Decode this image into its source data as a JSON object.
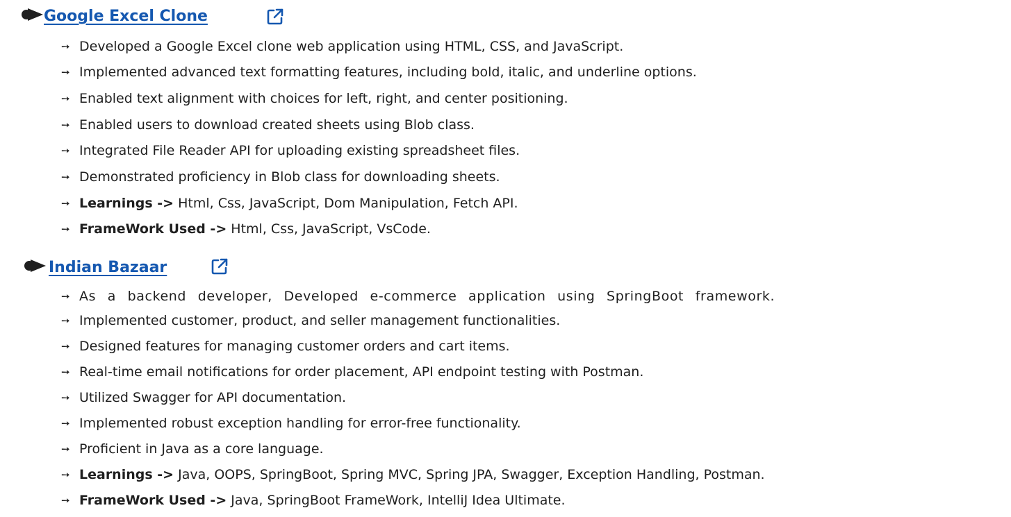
{
  "projects": [
    {
      "title": "Google Excel Clone",
      "icon": "external-link-icon",
      "bullet_icon": "arrow-bullet-icon",
      "items": [
        {
          "text": "Developed a Google Excel clone web application using HTML, CSS, and JavaScript."
        },
        {
          "text": "Implemented advanced text formatting features, including bold, italic, and underline options."
        },
        {
          "text": "Enabled text alignment with choices for left, right, and center positioning."
        },
        {
          "text": "Enabled users to download created sheets using Blob class."
        },
        {
          "text": "Integrated File Reader API for uploading existing spreadsheet files."
        },
        {
          "text": "Demonstrated proficiency in Blob class for downloading sheets."
        },
        {
          "label": "Learnings ->",
          "text": "Html, Css, JavaScript, Dom Manipulation, Fetch API."
        },
        {
          "label": "FrameWork Used ->",
          "text": "Html, Css, JavaScript, VsCode."
        }
      ]
    },
    {
      "title": "Indian Bazaar",
      "icon": "external-link-icon",
      "bullet_icon": "arrow-bullet-icon",
      "items": [
        {
          "text": "As a backend developer, Developed e-commerce application using SpringBoot framework."
        },
        {
          "text": "Implemented customer, product, and seller management functionalities."
        },
        {
          "text": "Designed features for managing customer orders and cart items."
        },
        {
          "text": "Real-time email notifications for order placement, API endpoint testing with Postman."
        },
        {
          "text": "Utilized Swagger for API documentation."
        },
        {
          "text": "Implemented robust exception handling for error-free functionality."
        },
        {
          "text": "Proficient in Java as a core language."
        },
        {
          "label": "Learnings ->",
          "text": "Java, OOPS, SpringBoot, Spring MVC, Spring JPA, Swagger, Exception Handling, Postman."
        },
        {
          "label": "FrameWork Used ->",
          "text": "Java, SpringBoot FrameWork, IntelliJ Idea Ultimate."
        }
      ]
    }
  ],
  "colors": {
    "link": "#1558b0",
    "text": "#1f1f1f",
    "bullet": "#1f1f1f"
  }
}
